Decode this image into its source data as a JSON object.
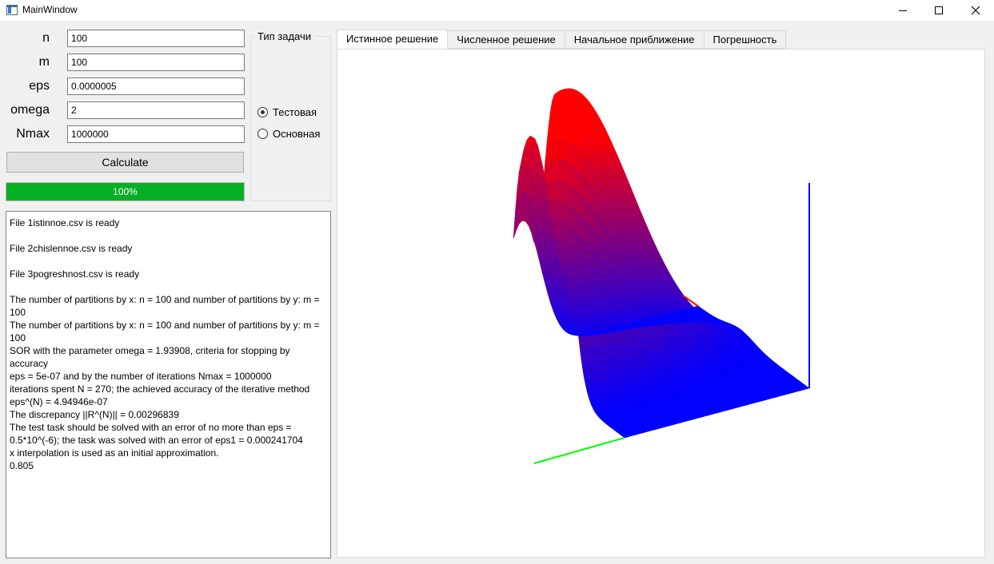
{
  "window": {
    "title": "MainWindow",
    "minimize_icon": "minimize-icon",
    "maximize_icon": "maximize-icon",
    "close_icon": "close-icon"
  },
  "params": [
    {
      "label": "n",
      "value": "100"
    },
    {
      "label": "m",
      "value": "100"
    },
    {
      "label": "eps",
      "value": "0.0000005"
    },
    {
      "label": "omega",
      "value": "2"
    },
    {
      "label": "Nmax",
      "value": "1000000"
    }
  ],
  "calculate_label": "Calculate",
  "progress": {
    "value": 100,
    "text": "100%",
    "color": "#06b025"
  },
  "task_type": {
    "title": "Тип задачи",
    "options": [
      {
        "label": "Тестовая",
        "checked": true
      },
      {
        "label": "Основная",
        "checked": false
      }
    ]
  },
  "log_lines": [
    "File 1istinnoe.csv is ready",
    "",
    "File 2chislennoe.csv is ready",
    "",
    "File 3pogreshnost.csv is ready",
    "",
    "The number of partitions by x: n = 100 and number of partitions by y: m =",
    "100",
    "The number of partitions by x: n = 100 and number of partitions by y: m =",
    "100",
    "SOR with the parameter omega = 1.93908, criteria for stopping by accuracy",
    "eps = 5e-07 and by the number of iterations Nmax = 1000000",
    "iterations spent N = 270; the achieved accuracy of the iterative method",
    "eps^(N) = 4.94946e-07",
    "The discrepancy ||R^(N)|| = 0.00296839",
    "The test task should be solved with an error of no more than eps =",
    "0.5*10^(-6); the task was solved with an error of eps1 = 0.000241704",
    "x interpolation is used as an initial approximation.",
    "0.805"
  ],
  "tabs": [
    {
      "label": "Истинное решение",
      "active": true
    },
    {
      "label": "Численное решение",
      "active": false
    },
    {
      "label": "Начальное приближение",
      "active": false
    },
    {
      "label": "Погрешность",
      "active": false
    }
  ],
  "plot": {
    "axis_colors": {
      "x": "#ff0000",
      "y": "#00ff00",
      "z": "#0000ff"
    },
    "surface_colors": {
      "high": "#ff0000",
      "low": "#0000ff"
    }
  }
}
